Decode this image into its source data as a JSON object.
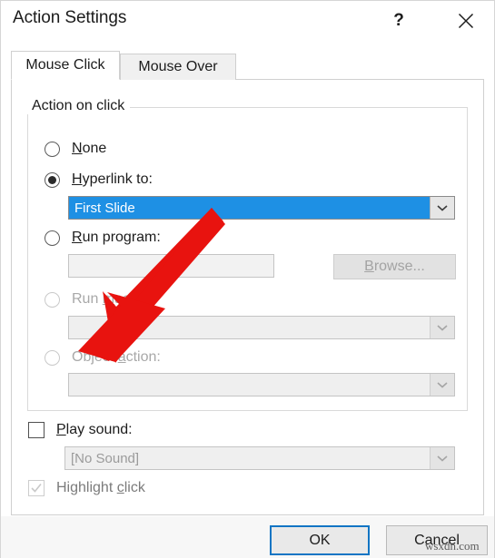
{
  "window": {
    "title": "Action Settings",
    "help_icon": "question-mark-icon",
    "close_icon": "close-icon"
  },
  "tabs": [
    {
      "label": "Mouse Click",
      "active": true
    },
    {
      "label": "Mouse Over",
      "active": false
    }
  ],
  "group": {
    "label": "Action on click"
  },
  "options": [
    {
      "id": "none",
      "label_prefix": "",
      "accel": "N",
      "label_suffix": "one",
      "selected": false,
      "enabled": true
    },
    {
      "id": "hyperlink",
      "label_prefix": "",
      "accel": "H",
      "label_suffix": "yperlink to:",
      "selected": true,
      "enabled": true
    },
    {
      "id": "run-program",
      "label_prefix": "",
      "accel": "R",
      "label_suffix": "un program:",
      "selected": false,
      "enabled": true
    },
    {
      "id": "run-macro",
      "label_prefix": "Run ",
      "accel": "m",
      "label_suffix": "acro:",
      "selected": false,
      "enabled": false
    },
    {
      "id": "object-action",
      "label_prefix": "Object ",
      "accel": "a",
      "label_suffix": "ction:",
      "selected": false,
      "enabled": false
    }
  ],
  "hyperlink_combo": {
    "value": "First Slide",
    "arrow_icon": "chevron-down-icon",
    "selected": true
  },
  "run_program": {
    "path_value": "",
    "browse_prefix": "",
    "browse_accel": "B",
    "browse_suffix": "rowse...",
    "enabled": false
  },
  "run_macro_combo": {
    "value": "",
    "arrow_icon": "chevron-down-icon",
    "enabled": false
  },
  "object_action_combo": {
    "value": "",
    "arrow_icon": "chevron-down-icon",
    "enabled": false
  },
  "play_sound": {
    "prefix": "",
    "accel": "P",
    "suffix": "lay sound:",
    "checked": false,
    "enabled": true
  },
  "sound_combo": {
    "value": "[No Sound]",
    "arrow_icon": "chevron-down-icon",
    "enabled": false
  },
  "highlight_click": {
    "prefix": "Highlight ",
    "accel": "c",
    "suffix": "lick",
    "checked": true,
    "enabled": false
  },
  "footer": {
    "ok_label": "OK",
    "cancel_label": "Cancel"
  },
  "annotation": {
    "arrow_color": "#e8130f",
    "type": "arrow-pointing-down-left"
  },
  "watermark": {
    "text": "wsxdn.com"
  },
  "colors": {
    "selection_blue": "#1e90e4",
    "focus_blue": "#1275c4",
    "disabled_text": "#a8a8a8",
    "dialog_bg": "#ffffff",
    "footer_bg": "#f7f7f7"
  }
}
